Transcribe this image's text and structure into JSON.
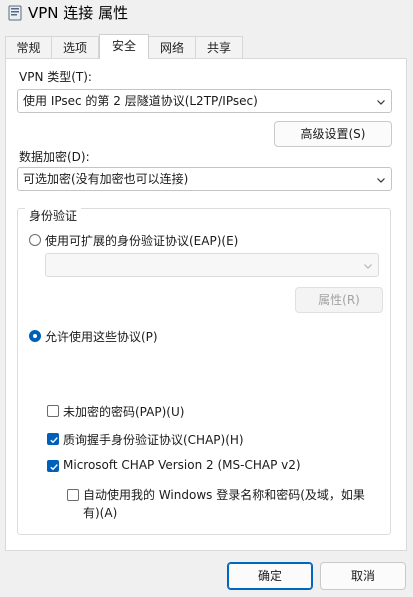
{
  "window": {
    "title": "VPN 连接 属性"
  },
  "tabs": [
    {
      "label": "常规",
      "active": false
    },
    {
      "label": "选项",
      "active": false
    },
    {
      "label": "安全",
      "active": true
    },
    {
      "label": "网络",
      "active": false
    },
    {
      "label": "共享",
      "active": false
    }
  ],
  "security": {
    "vpn_type_label": "VPN 类型(T):",
    "vpn_type_value": "使用 IPsec 的第 2 层隧道协议(L2TP/IPsec)",
    "advanced_button": "高级设置(S)",
    "encryption_label": "数据加密(D):",
    "encryption_value": "可选加密(没有加密也可以连接)",
    "auth_group_title": "身份验证",
    "eap_radio_label": "使用可扩展的身份验证协议(EAP)(E)",
    "eap_radio_checked": false,
    "eap_select_value": "",
    "properties_button": "属性(R)",
    "allow_protocols_label": "允许使用这些协议(P)",
    "allow_protocols_checked": true,
    "protocols": [
      {
        "label": "未加密的密码(PAP)(U)",
        "checked": false
      },
      {
        "label": "质询握手身份验证协议(CHAP)(H)",
        "checked": true
      },
      {
        "label": "Microsoft CHAP Version 2 (MS-CHAP v2)",
        "checked": true
      }
    ],
    "auto_logon_line1": "自动使用我的 Windows 登录名称和密码(及域，如果",
    "auto_logon_line2": "有)(A)",
    "auto_logon_checked": false
  },
  "footer": {
    "ok_label": "确定",
    "cancel_label": "取消"
  },
  "colors": {
    "accent": "#005fb8",
    "window_bg": "#f0f0f0",
    "panel_bg": "#ffffff"
  }
}
